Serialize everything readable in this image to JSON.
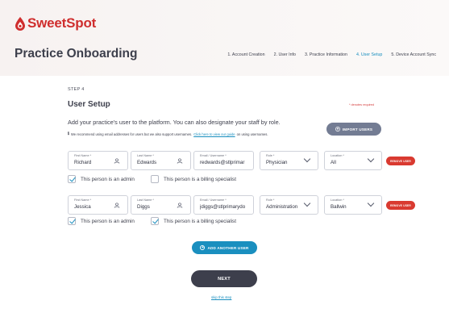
{
  "brand": {
    "name": "SweetSpot",
    "color": "#cf2e2e"
  },
  "header": {
    "title": "Practice Onboarding",
    "steps": [
      {
        "label": "1. Account Creation",
        "active": false
      },
      {
        "label": "2. User Info",
        "active": false
      },
      {
        "label": "3. Practice Information",
        "active": false
      },
      {
        "label": "4. User Setup",
        "active": true
      },
      {
        "label": "5. Device Account Sync",
        "active": false
      }
    ]
  },
  "main": {
    "step_label": "STEP 4",
    "title": "User Setup",
    "required_note": "* denotes required",
    "intro": "Add your practice's user to the platform. You can also designate your staff by role.",
    "recommend_text": "We recommend using email addresses for users but we also support usernames.",
    "recommend_link": "Click here to view our guide",
    "recommend_suffix": "on using usernames.",
    "import_label": "IMPORT USERS",
    "field_labels": {
      "first": "First Name *",
      "last": "Last Name *",
      "email": "Email / Username *",
      "role": "Role *",
      "location": "Location *"
    },
    "remove_label": "REMOVE USER",
    "admin_label": "This person is an admin",
    "billing_label": "This person is a billing specialist",
    "users": [
      {
        "first": "Richard",
        "last": "Edwards",
        "email": "redwards@stlprimar",
        "role": "Physician",
        "location": "All",
        "admin": true,
        "billing": false
      },
      {
        "first": "Jessica",
        "last": "Diggs",
        "email": "jdiggs@stlprimarydo",
        "role": "Administration",
        "location": "Ballwin",
        "admin": true,
        "billing": true
      }
    ],
    "add_label": "ADD ANOTHER USER",
    "next_label": "NEXT",
    "skip_label": "skip this step"
  },
  "colors": {
    "accent": "#1a8fbf",
    "danger": "#d93a30",
    "dark_button": "#3d3f4c",
    "import_button": "#737c93"
  }
}
